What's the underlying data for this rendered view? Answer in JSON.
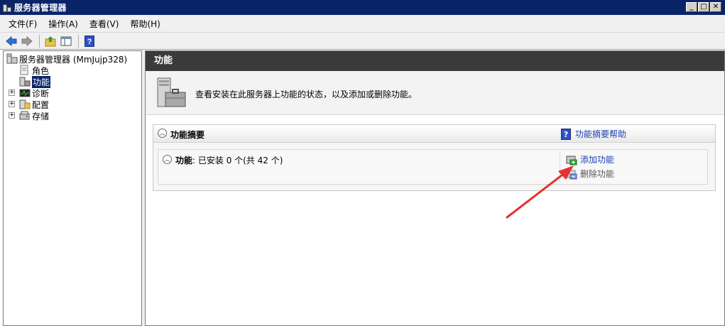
{
  "window": {
    "title": "服务器管理器",
    "controls": [
      "_",
      "□",
      "✕"
    ]
  },
  "menu": [
    {
      "label": "文件(F)"
    },
    {
      "label": "操作(A)"
    },
    {
      "label": "查看(V)"
    },
    {
      "label": "帮助(H)"
    }
  ],
  "tree": {
    "root": "服务器管理器 (MmJujp328)",
    "items": [
      {
        "label": "角色"
      },
      {
        "label": "功能"
      },
      {
        "label": "诊断"
      },
      {
        "label": "配置"
      },
      {
        "label": "存储"
      }
    ],
    "selected": "功能"
  },
  "main": {
    "header": "功能",
    "description": "查看安装在此服务器上功能的状态，以及添加或删除功能。",
    "summary": {
      "title": "功能摘要",
      "help_link": "功能摘要帮助",
      "status_label": "功能",
      "status_text": ": 已安装 0 个(共 42 个)",
      "actions": {
        "add": "添加功能",
        "remove": "删除功能"
      }
    }
  },
  "colors": {
    "titlebar": "#0a246a",
    "header_bar": "#3a3a3a",
    "link": "#1a3fb5",
    "annotation_arrow": "#e8312f"
  }
}
